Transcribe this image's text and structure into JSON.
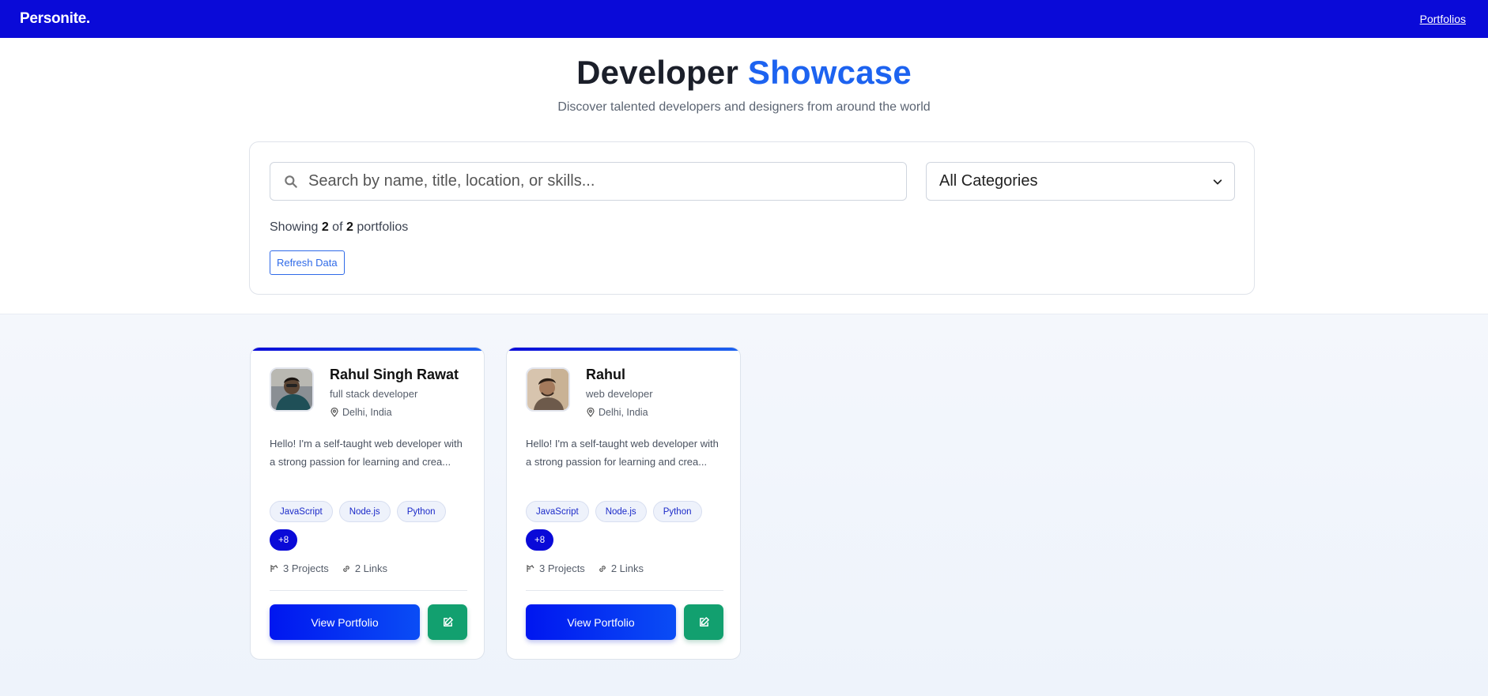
{
  "nav": {
    "brand": "Personite.",
    "link": "Portfolios"
  },
  "hero": {
    "title_main": "Developer ",
    "title_accent": "Showcase",
    "subtitle": "Discover talented developers and designers from around the world"
  },
  "filters": {
    "search_placeholder": "Search by name, title, location, or skills...",
    "category_selected": "All Categories",
    "showing_prefix": "Showing ",
    "shown_count": "2",
    "of_text": " of ",
    "total_count": "2",
    "showing_suffix": " portfolios",
    "refresh_label": "Refresh Data"
  },
  "cards": [
    {
      "name": "Rahul Singh Rawat",
      "role": "full stack developer",
      "location": "Delhi, India",
      "bio": "Hello! I'm a self-taught web developer with a strong passion for learning and crea...",
      "skills": [
        "JavaScript",
        "Node.js",
        "Python"
      ],
      "more": "+8",
      "projects": "3 Projects",
      "links": "2 Links",
      "view_label": "View Portfolio"
    },
    {
      "name": "Rahul",
      "role": "web developer",
      "location": "Delhi, India",
      "bio": "Hello! I'm a self-taught web developer with a strong passion for learning and crea...",
      "skills": [
        "JavaScript",
        "Node.js",
        "Python"
      ],
      "more": "+8",
      "projects": "3 Projects",
      "links": "2 Links",
      "view_label": "View Portfolio"
    }
  ],
  "colors": {
    "nav_bg": "#0a0ad8",
    "accent": "#1d63f0",
    "edit_green": "#12a06f"
  }
}
